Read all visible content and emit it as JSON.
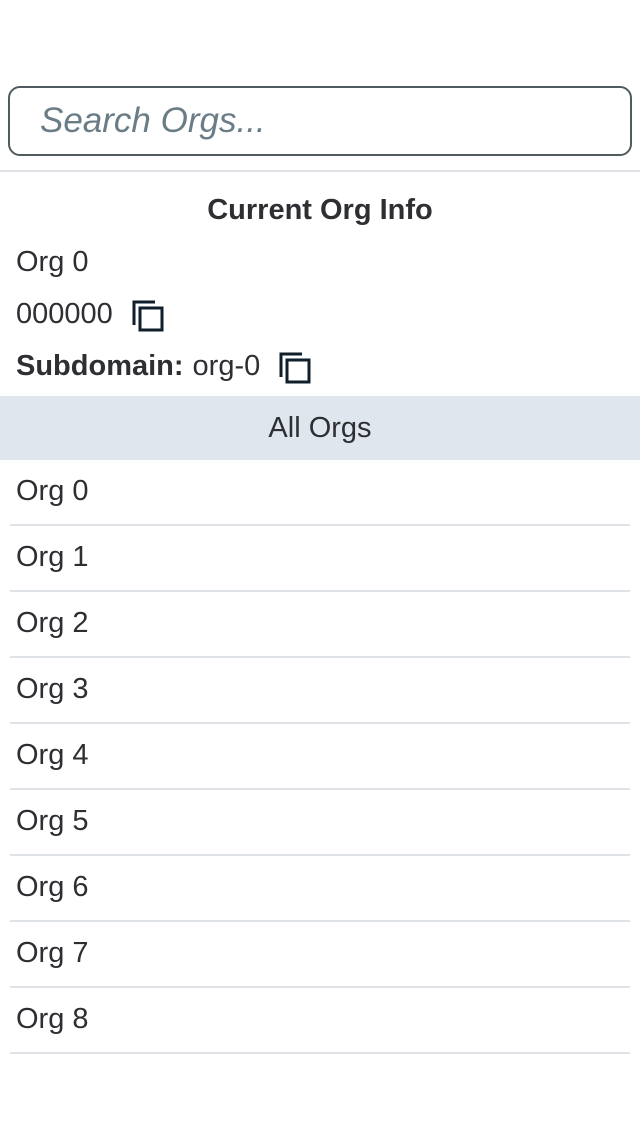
{
  "search": {
    "placeholder": "Search Orgs...",
    "value": ""
  },
  "current_org": {
    "heading": "Current Org Info",
    "name": "Org 0",
    "id": "000000",
    "subdomain_label": "Subdomain:",
    "subdomain": "org-0",
    "copy_icon": "copy-icon"
  },
  "all_orgs": {
    "heading": "All Orgs",
    "items": [
      {
        "label": "Org 0"
      },
      {
        "label": "Org 1"
      },
      {
        "label": "Org 2"
      },
      {
        "label": "Org 3"
      },
      {
        "label": "Org 4"
      },
      {
        "label": "Org 5"
      },
      {
        "label": "Org 6"
      },
      {
        "label": "Org 7"
      },
      {
        "label": "Org 8"
      }
    ]
  },
  "colors": {
    "text": "#2d2f33",
    "header_bg": "#e0e6ed",
    "divider": "#dfe3e7",
    "input_border": "#4f5b5f",
    "icon": "#0f1f2b"
  }
}
